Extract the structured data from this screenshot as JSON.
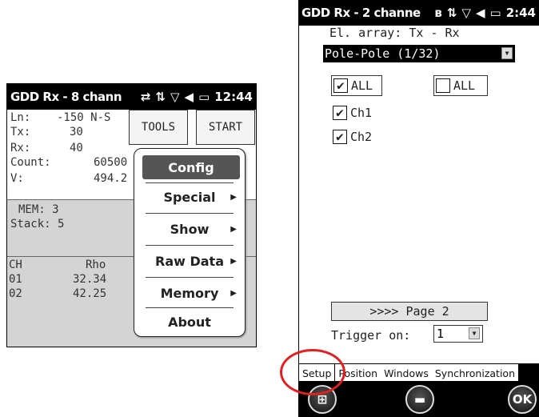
{
  "left": {
    "status": {
      "title": "GDD Rx - 8 chann",
      "time": "12:44"
    },
    "info": {
      "ln_label": "Ln:",
      "ln_value": "-150 N-S",
      "tx_label": "Tx:",
      "tx_value": "30",
      "rx_label": "Rx:",
      "rx_value": "40",
      "count_label": "Count:",
      "count_value": "60500",
      "v_label": "V:",
      "v_value": "494.2"
    },
    "buttons": {
      "tools": "TOOLS",
      "start": "START"
    },
    "mem": {
      "mem": "MEM: 3",
      "stack": "Stack: 5"
    },
    "table": {
      "headers": [
        "CH",
        "Rho"
      ],
      "rows": [
        [
          "01",
          "32.34"
        ],
        [
          "02",
          "42.25"
        ]
      ]
    },
    "menu": {
      "items": [
        {
          "label": "Config",
          "submenu": false
        },
        {
          "label": "Special",
          "submenu": true
        },
        {
          "label": "Show",
          "submenu": true
        },
        {
          "label": "Raw Data",
          "submenu": true
        },
        {
          "label": "Memory",
          "submenu": true
        },
        {
          "label": "About",
          "submenu": false
        }
      ]
    }
  },
  "right": {
    "status": {
      "title": "GDD Rx - 2 channe",
      "time": "2:44"
    },
    "array_label": "El. array: Tx - Rx",
    "array_value": "Pole-Pole (1/32)",
    "all_checked_label": "ALL",
    "all_unchecked_label": "ALL",
    "channels": [
      "Ch1",
      "Ch2"
    ],
    "page_button": ">>>> Page 2",
    "trigger_label": "Trigger on:",
    "trigger_value": "1",
    "tabs": [
      "Setup",
      "Position",
      "Windows",
      "Synchronization"
    ],
    "ok_label": "OK"
  },
  "icons": [
    "bluetooth-icon",
    "sync-icon",
    "signal-off-icon",
    "volume-icon",
    "battery-icon",
    "windows-start-icon",
    "keyboard-icon"
  ],
  "colors": {
    "highlight_circle": "#e02020",
    "status_bar": "#000000",
    "selected_menu": "#555555"
  }
}
